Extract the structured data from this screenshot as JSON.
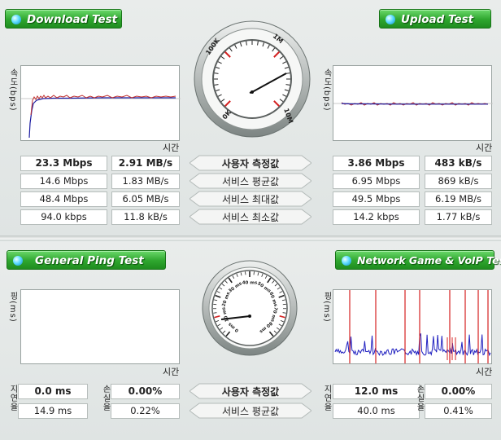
{
  "download": {
    "title": "Download Test",
    "ylabel": "속도(bps)",
    "xlabel": "시간",
    "rows": [
      [
        "23.3 Mbps",
        "2.91 MB/s"
      ],
      [
        "14.6 Mbps",
        "1.83 MB/s"
      ],
      [
        "48.4 Mbps",
        "6.05 MB/s"
      ],
      [
        "94.0 kbps",
        "11.8 kB/s"
      ]
    ]
  },
  "upload": {
    "title": "Upload Test",
    "ylabel": "속도(bps)",
    "xlabel": "시간",
    "rows": [
      [
        "3.86 Mbps",
        "483 kB/s"
      ],
      [
        "6.95 Mbps",
        "869 kB/s"
      ],
      [
        "49.5 Mbps",
        "6.19 MB/s"
      ],
      [
        "14.2 kbps",
        "1.77 kB/s"
      ]
    ]
  },
  "center_labels": [
    "사용자 측정값",
    "서비스 평균값",
    "서비스 최대값",
    "서비스 최소값"
  ],
  "speed_gauge": {
    "labels": [
      "0K",
      "100K",
      "1M",
      "10M"
    ]
  },
  "ping": {
    "title": "General Ping Test",
    "ylabel": "핑(ms)",
    "xlabel": "시간",
    "latency_label": "지연율",
    "loss_label": "손실율",
    "rows": [
      [
        "0.0 ms",
        "0.00%"
      ],
      [
        "14.9 ms",
        "0.22%"
      ]
    ]
  },
  "game": {
    "title": "Network Game & VoIP Test",
    "ylabel": "핑(ms)",
    "xlabel": "시간",
    "latency_label": "지연율",
    "loss_label": "손실율",
    "rows": [
      [
        "12.0 ms",
        "0.00%"
      ],
      [
        "40.0 ms",
        "0.41%"
      ]
    ]
  },
  "ping_center_labels": [
    "사용자 측정값",
    "서비스 평균값"
  ],
  "ping_gauge": {
    "labels": [
      "0 ms",
      "10 ms",
      "20 ms",
      "30 ms",
      "40 ms",
      "50 ms",
      "60 ms",
      "70 ms",
      "80 ms"
    ]
  },
  "colors": {
    "green": "#2ea62e",
    "red": "#d42020",
    "blue": "#2020c0"
  }
}
